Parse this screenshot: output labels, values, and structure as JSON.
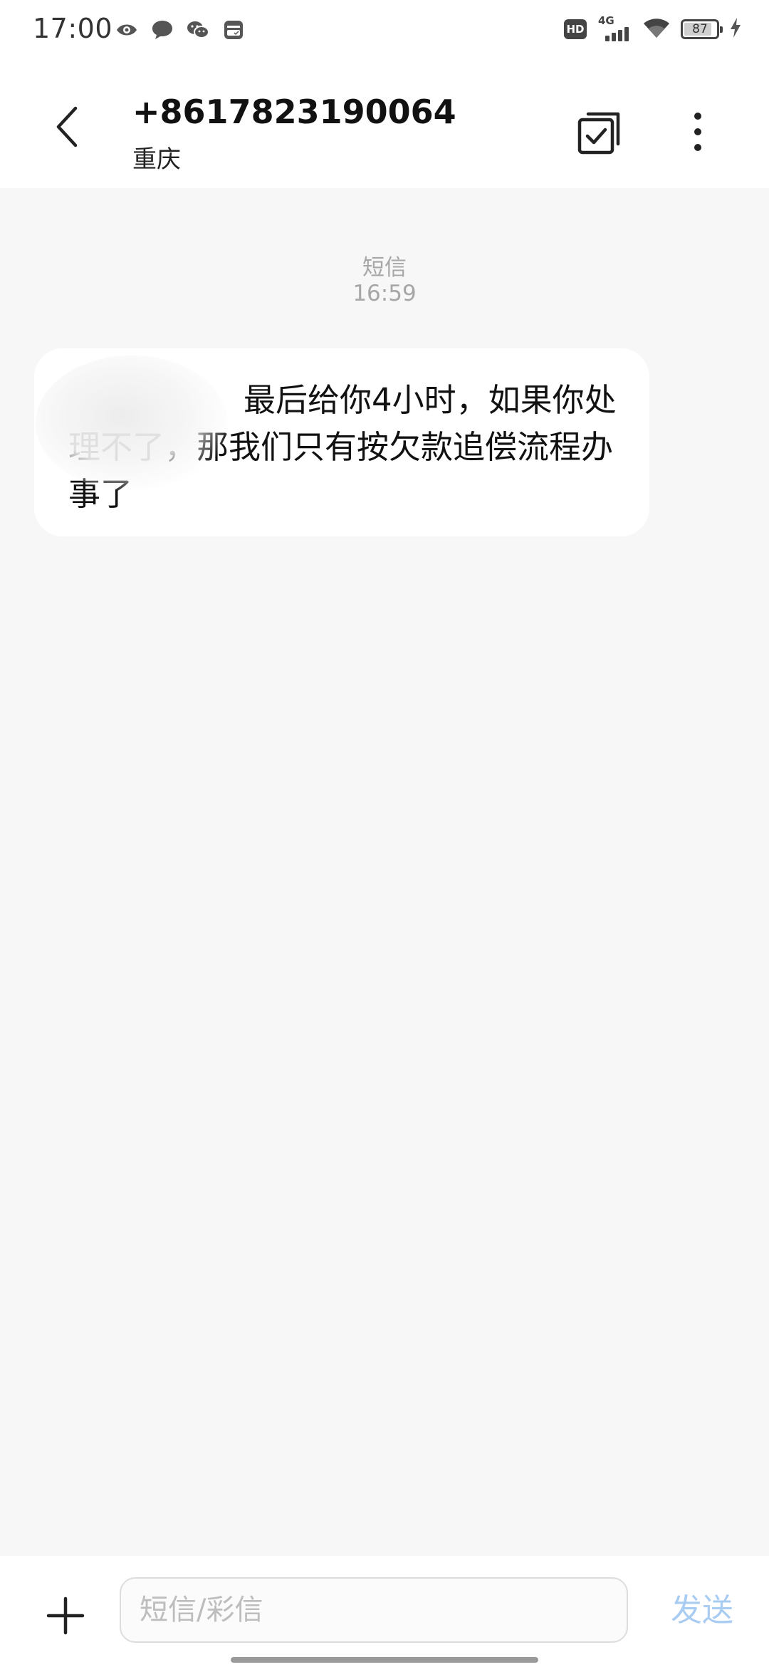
{
  "status_bar": {
    "time": "17:00",
    "left_icons": [
      "eye-icon",
      "chat-bubble-icon",
      "wechat-icon",
      "wallet-icon"
    ],
    "hd_label": "HD",
    "network_label": "4G",
    "battery_level": "87",
    "battery_fraction": 0.87,
    "charging": true
  },
  "header": {
    "contact_number": "+8617823190064",
    "contact_location": "重庆",
    "icons": {
      "back": "chevron-left-icon",
      "multiselect": "checkbox-stack-icon",
      "more": "more-vertical-icon"
    }
  },
  "conversation": {
    "channel_label": "短信",
    "timestamp": "16:59",
    "message": {
      "text": "最后给你4小时，如果你处理不了，那我们只有按欠款追偿流程办事了",
      "redacted_prefix": true
    }
  },
  "input_bar": {
    "placeholder": "短信/彩信",
    "send_label": "发送",
    "send_color": "#a9ccf2",
    "add_icon": "plus-icon"
  }
}
